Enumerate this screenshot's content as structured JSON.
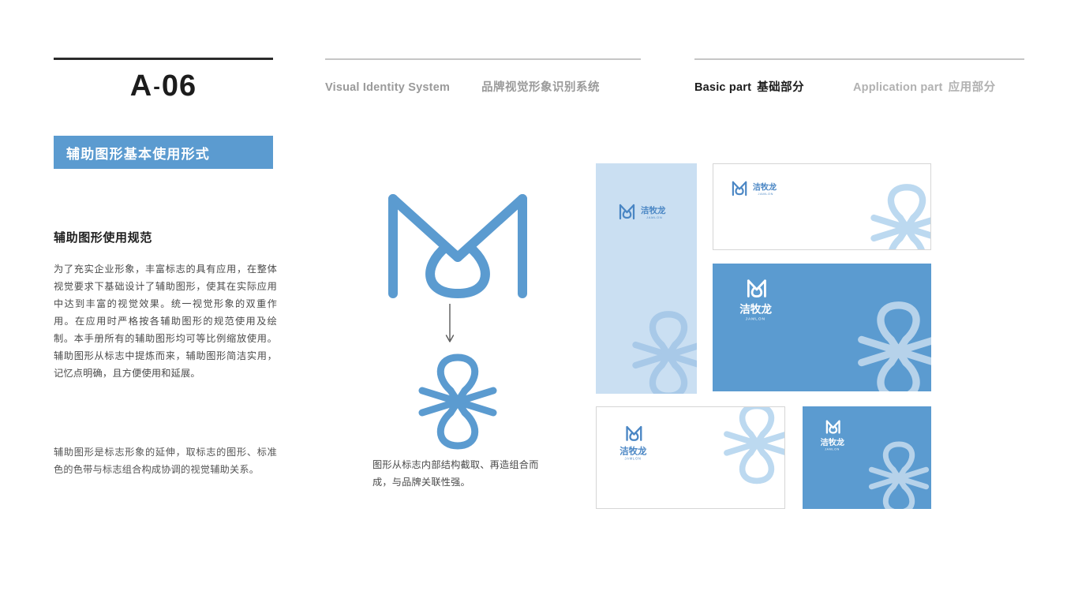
{
  "header": {
    "page_code_letter": "A",
    "page_code_dash": "-",
    "page_code_number": "06",
    "nav": [
      {
        "en": "Visual Identity System",
        "cn": "品牌视觉形象识别系统",
        "active": false
      },
      {
        "en": "Basic part",
        "cn": "基础部分",
        "active": true
      },
      {
        "en": "Application part",
        "cn": "应用部分",
        "active": false
      }
    ]
  },
  "sidebar": {
    "banner_title": "辅助图形基本使用形式",
    "section_title": "辅助图形使用规范",
    "body_paragraph": "为了充实企业形象，丰富标志的具有应用，在整体视觉要求下基础设计了辅助图形，使其在实际应用中达到丰富的视觉效果。统一视觉形象的双重作用。在应用时严格按各辅助图形的规范使用及绘制。本手册所有的辅助图形均可等比例缩放使用。辅助图形从标志中提炼而来，辅助图形简洁实用，记忆点明确，且方便使用和延展。",
    "footer_paragraph": "辅助图形是标志形象的延伸，取标志的图形、标准色的色带与标志组合构成协调的视觉辅助关系。"
  },
  "derivation": {
    "caption": "图形从标志内部结构截取、再造组合而成，与品牌关联性强。",
    "source_mark_name": "M 标志",
    "result_graphic_name": "辅助图形"
  },
  "brand": {
    "name_cn": "洁牧龙",
    "name_en": "JAMLON"
  },
  "mockups": [
    {
      "id": "a",
      "style": "light-blue",
      "lockup": "horizontal",
      "logo_color": "blue"
    },
    {
      "id": "b",
      "style": "white",
      "lockup": "horizontal",
      "logo_color": "blue"
    },
    {
      "id": "c",
      "style": "blue",
      "lockup": "stacked",
      "logo_color": "white"
    },
    {
      "id": "d",
      "style": "white",
      "lockup": "stacked",
      "logo_color": "blue"
    },
    {
      "id": "e",
      "style": "blue",
      "lockup": "stacked",
      "logo_color": "white"
    }
  ],
  "colors": {
    "brand_blue": "#5b9bd0",
    "light_blue": "#cadff2",
    "deco_on_light": "#a8c9e8",
    "deco_on_blue": "#b6d2ea",
    "deco_on_white": "#bcd9f0",
    "text_dark": "#1c1c1c",
    "text_body": "#4a4a4a",
    "text_muted": "#9a9a9a"
  }
}
